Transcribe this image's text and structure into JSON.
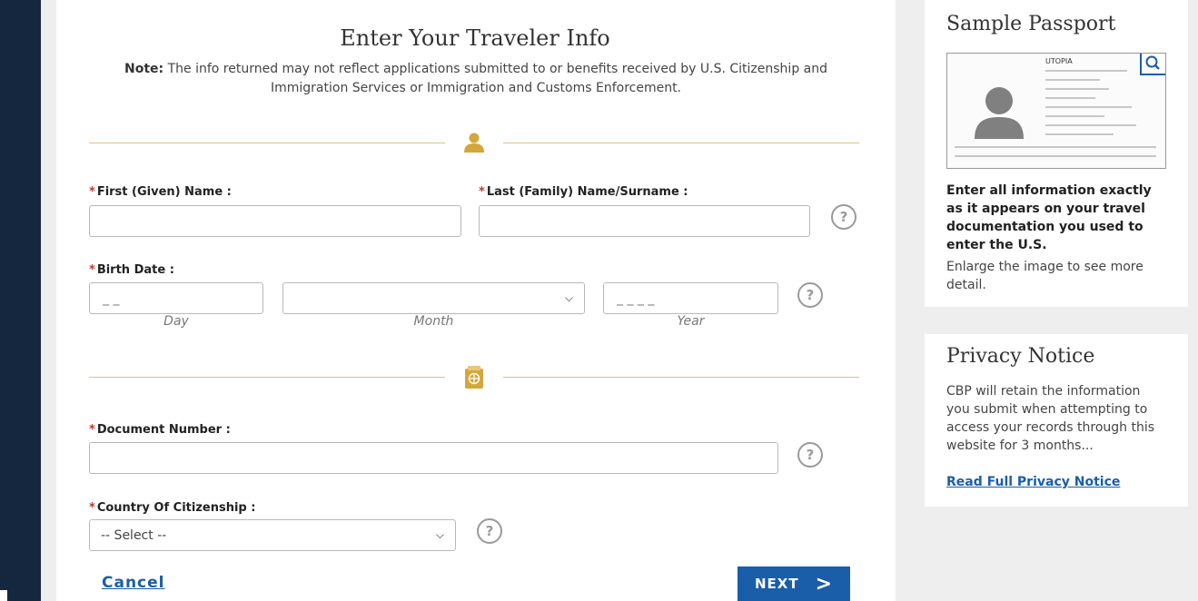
{
  "form": {
    "title": "Enter Your Traveler Info",
    "note_label": "Note:",
    "note_text": "The info returned may not reflect applications submitted to or benefits received by U.S. Citizenship and Immigration Services or Immigration and Customs Enforcement.",
    "first_name": {
      "label": "First (Given) Name :",
      "value": ""
    },
    "last_name": {
      "label": "Last (Family) Name/Surname :",
      "value": ""
    },
    "birth_date": {
      "label": "Birth Date :",
      "day_placeholder": "_ _",
      "month_value": "",
      "year_placeholder": "_ _ _ _",
      "day_sublabel": "Day",
      "month_sublabel": "Month",
      "year_sublabel": "Year"
    },
    "document_number": {
      "label": "Document Number :",
      "value": ""
    },
    "country": {
      "label": "Country Of Citizenship :",
      "selected": "-- Select --"
    },
    "required_marker": "*",
    "help_glyph": "?",
    "cancel_label": "Cancel",
    "next_label": "NEXT",
    "next_glyph": ">"
  },
  "sidebar": {
    "sample_passport": {
      "title": "Sample Passport",
      "passport_country": "UTOPIA",
      "instruction_bold": "Enter all information exactly as it appears on your travel documentation you used to enter the U.S.",
      "instruction_text": "Enlarge the image to see more detail."
    },
    "privacy": {
      "title": "Privacy Notice",
      "text": "CBP will retain the information you submit when attempting to access your records through this website for 3 months...",
      "link": "Read Full Privacy Notice"
    }
  },
  "colors": {
    "accent_gold": "#d4a73a",
    "link_blue": "#1a5ea8",
    "required_red": "#c0392b",
    "page_navy": "#15263f"
  },
  "icons": {
    "person": "person-icon",
    "passport": "passport-icon",
    "help": "help-icon",
    "zoom": "search-icon",
    "chevron": "chevron-down-icon",
    "next_arrow": "chevron-right-icon"
  }
}
